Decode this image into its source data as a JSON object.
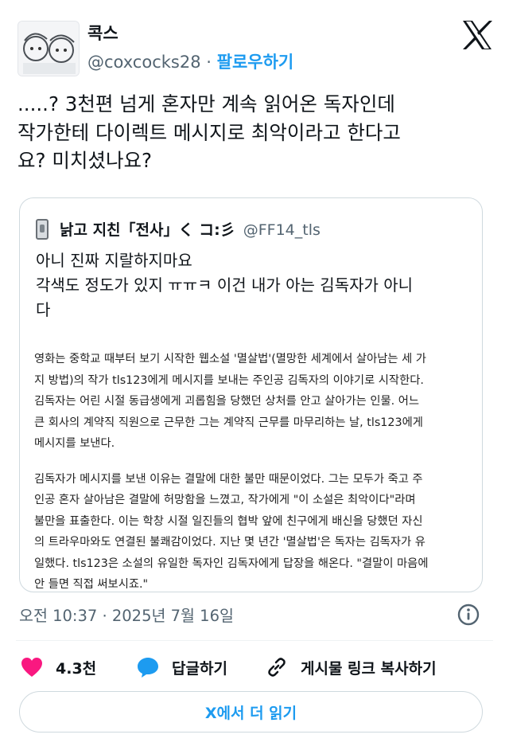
{
  "author": {
    "name": "콕스",
    "handle": "@coxcocks28",
    "separator": "·",
    "follow_label": "팔로우하기"
  },
  "tweet": {
    "lines": [
      ".....? 3천편 넘게 혼자만 계속 읽어온 독자인데",
      "작가한테 다이렉트 메시지로 최악이라고 한다고",
      "요? 미치셨나요?"
    ]
  },
  "quoted": {
    "name": "낡고 지친「전사」く コ:彡",
    "handle": "@FF14_tls",
    "lines": [
      "아니 진짜 지랄하지마요",
      "각색도 정도가 있지 ㅠㅠㅋ 이건 내가 아는 김독자가 아니",
      "다"
    ],
    "article_para1": [
      "영화는 중학교 때부터 보기 시작한 웹소설 '멸살법'(멸망한 세계에서 살아남는 세 가",
      "지 방법)의 작가 tls123에게 메시지를 보내는 주인공 김독자의 이야기로 시작한다.",
      "김독자는 어린 시절 동급생에게 괴롭힘을 당했던 상처를 안고 살아가는 인물. 어느",
      "큰 회사의 계약직 직원으로 근무한 그는 계약직 근무를 마무리하는 날, tls123에게",
      "메시지를 보낸다."
    ],
    "article_para2": [
      "김독자가 메시지를 보낸 이유는 결말에 대한 불만 때문이었다. 그는 모두가 죽고 주",
      "인공 혼자 살아남은 결말에 허망함을 느꼈고, 작가에게 \"이 소설은 최악이다\"라며",
      "불만을 표출한다. 이는 학창 시절 일진들의 협박 앞에 친구에게 배신을 당했던 자신",
      "의 트라우마와도 연결된 불쾌감이었다. 지난 몇 년간 '멸살법'은 독자는 김독자가 유",
      "일했다. tls123은 소설의 유일한 독자인 김독자에게 답장을 해온다. \"결말이 마음에",
      "안 들면 직접 써보시죠.\""
    ]
  },
  "timestamp": "오전 10:37 · 2025년 7월 16일",
  "actions": {
    "likes": "4.3천",
    "reply": "답글하기",
    "copy_link": "게시물 링크 복사하기"
  },
  "read_more": "X에서 더 읽기",
  "colors": {
    "accent": "#1d9bf0",
    "like": "#f91880",
    "muted": "#536471"
  }
}
